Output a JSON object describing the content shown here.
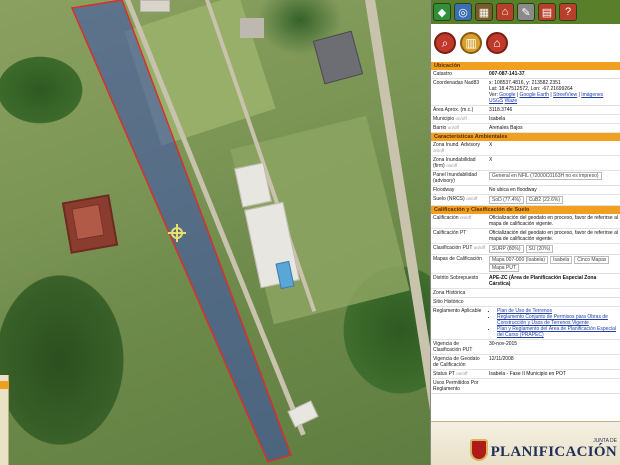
{
  "toolbar": {
    "icons": [
      "layers-icon",
      "globe-icon",
      "map-icon",
      "home-icon",
      "measure-icon",
      "print-icon",
      "help-icon"
    ],
    "accent": "#5a7f2a"
  },
  "actions": {
    "icons": [
      "search-icon",
      "chart-icon",
      "home-icon"
    ],
    "accent": "#c0392b"
  },
  "sections": {
    "ubicacion": "Ubicación",
    "ambientales": "Características Ambientales",
    "calificacion": "Calificación y Clasificación de Suelo"
  },
  "ubicacion": {
    "catastro_label": "Catastro",
    "catastro_value": "007-087-141-37",
    "coords_label": "Coordenadas Nad83",
    "coords_line1": "x: 108537.4816, y: 213582.2351",
    "coords_line2": "Lat: 18.47512572, Lon: -67.21699264",
    "ver_label": "Ver:",
    "links": [
      "Google",
      "Google Earth",
      "StreetView",
      "Imágenes USGS",
      "Waze"
    ],
    "area_label": "Área Aprox. (m.c.)",
    "area_value": "3118.3746",
    "municipio_label": "Municipio",
    "municipio_value": "Isabela",
    "barrio_label": "Barrio",
    "barrio_value": "Arenales Bajos",
    "info_tag": "on/off"
  },
  "ambientales": {
    "zona_adv_label": "Zona Inund. Advisory",
    "zona_adv_value": "X",
    "zona_firm_label": "Zona Inundabilidad (firm)",
    "zona_firm_value": "X",
    "panel_label": "Panel Inundabilidad (advisory)",
    "panel_value": "General en NFIL (72000C0163H no es impreso)",
    "floodway_label": "Floodway",
    "floodway_value": "No ubica en floodway",
    "suelo_label": "Suelo (NRCS)",
    "suelo_chips": [
      "SoD (77.4%)",
      "CuB2 (22.6%)"
    ]
  },
  "calificacion": {
    "calif_label": "Calificación",
    "calif_value": "Oficialización del geodato en proceso, favor de referirse al mapa de calificación vigente.",
    "calif_pt_label": "Calificación PT",
    "calif_pt_value": "Oficialización del geodato en proceso, favor de referirse al mapa de calificación vigente.",
    "clasif_label": "Clasificación PUT",
    "clasif_chips": [
      "SURP (80%)",
      "SU (20%)"
    ],
    "mapas_label": "Mapas de Calificación",
    "mapas_chips": [
      "Mapa 007-000 (Isabela)",
      "Isabela",
      "Cinco Mapas"
    ],
    "mapas_extra": "Mapa PUT",
    "distrito_label": "Distrito Sobrepuesto",
    "distrito_value": "APE-ZC (Área de Planificación Especial Zona Cárstica)",
    "zona_hist_label": "Zona Histórica",
    "sitio_hist_label": "Sitio Histórico",
    "reglamento_label": "Reglamento Aplicable",
    "reglamento_items": [
      "Plan de Uso de Terrenos",
      "Reglamento Conjunto de Permisos para Obras de Construcción y Usos de Terrenos Vigente",
      "Plan y Reglamento del Área de Planificación Especial del Carso (PRAPEC)"
    ],
    "vig_clasif_label": "Vigencia de Clasificación PUT",
    "vig_clasif_value": "30-nov-2015",
    "vig_geodato_label": "Vigencia de Geodato de Calificación",
    "vig_geodato_value": "12/11/2008",
    "status_label": "Status PT",
    "status_value": "Isabela - Fase II Municipio en POT",
    "usos_label": "Usos Permitidos Por Reglamento"
  },
  "footer": {
    "logo_small": "JUNTA DE",
    "logo_big": "PLANIFICACIÓN"
  },
  "colors": {
    "section": "#f0a020",
    "parcel_fill": "#3a4fb0",
    "parcel_stroke": "#d9302a"
  }
}
